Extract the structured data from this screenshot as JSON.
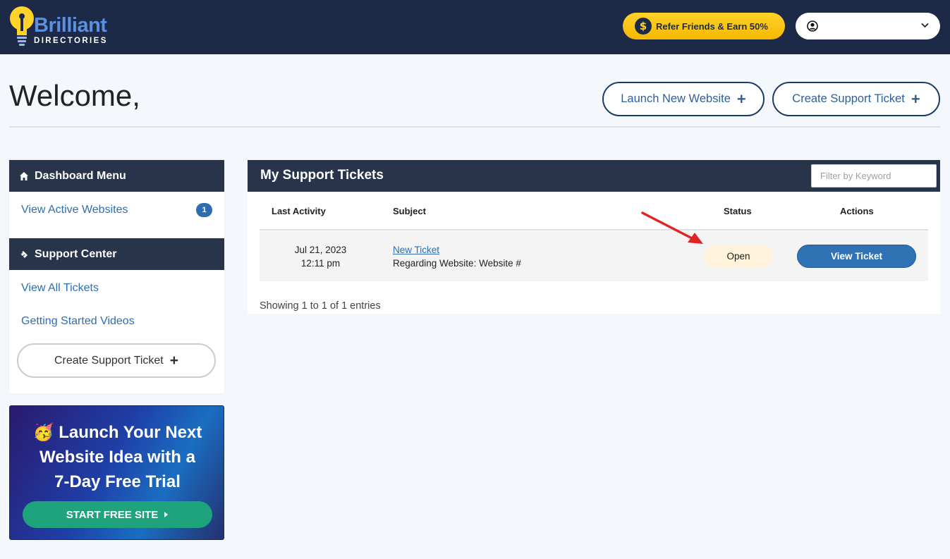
{
  "header": {
    "logo_word": "Brilliant",
    "logo_sub": "DIRECTORIES",
    "refer_label": "Refer Friends & Earn 50%",
    "refer_icon": "dollar-coin-icon",
    "user_name": ""
  },
  "welcome": {
    "title": "Welcome,",
    "launch_label": "Launch New Website",
    "create_ticket_label": "Create Support Ticket"
  },
  "sidebar": {
    "dashboard_title": "Dashboard Menu",
    "view_active_label": "View Active Websites",
    "active_count": "1",
    "support_title": "Support Center",
    "view_tickets_label": "View All Tickets",
    "videos_label": "Getting Started Videos",
    "create_ticket_label": "Create Support Ticket"
  },
  "promo": {
    "line1": "🥳 Launch Your Next",
    "line2": "Website Idea with a",
    "line3": "7-Day Free Trial",
    "cta_label": "START FREE SITE"
  },
  "tickets": {
    "title": "My Support Tickets",
    "filter_placeholder": "Filter by Keyword",
    "columns": [
      "Last Activity",
      "Subject",
      "Status",
      "Actions"
    ],
    "rows": [
      {
        "date": "Jul 21, 2023",
        "time": "12:11 pm",
        "subject": "New Ticket",
        "regarding": "Regarding Website: Website #",
        "status": "Open",
        "action_label": "View Ticket"
      }
    ],
    "showing": "Showing 1 to 1 of 1 entries"
  },
  "colors": {
    "navy": "#1c2a47",
    "panel_head": "#27344a",
    "link": "#2f6db1",
    "gold": "#ffd32a",
    "green": "#1ea37c",
    "arrow": "#e02424"
  }
}
